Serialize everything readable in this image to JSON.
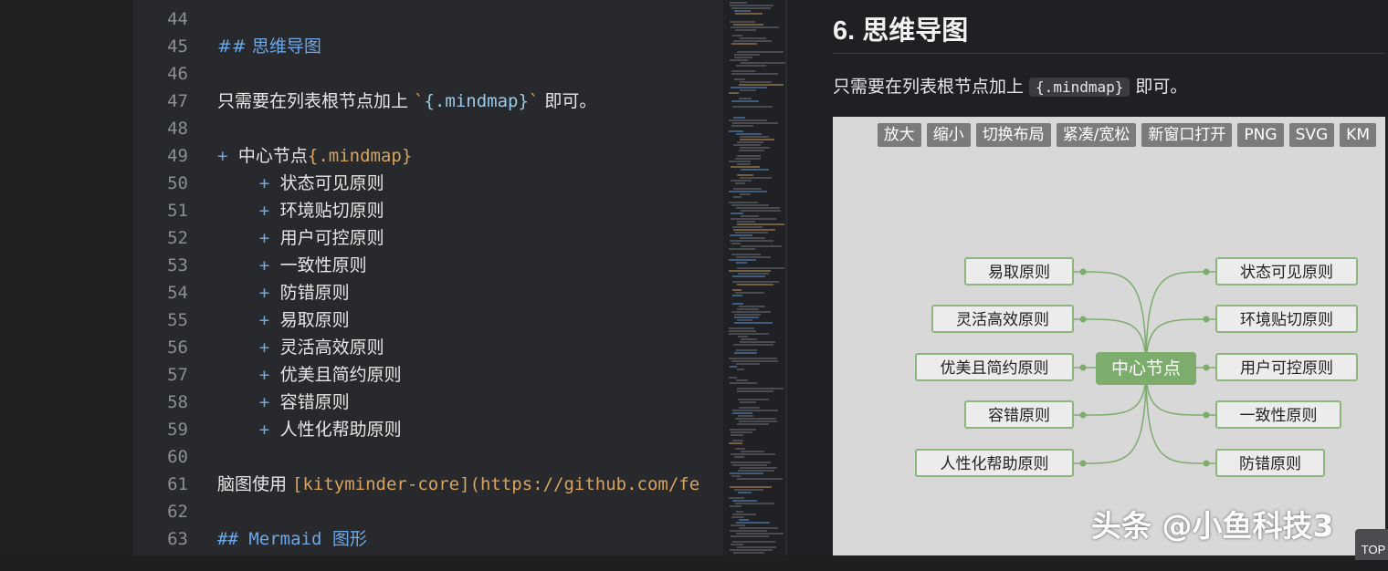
{
  "editor": {
    "lines": [
      {
        "num": "44",
        "parts": []
      },
      {
        "num": "45",
        "parts": [
          {
            "t": "## 思维导图",
            "c": "heading"
          }
        ]
      },
      {
        "num": "46",
        "parts": []
      },
      {
        "num": "47",
        "parts": [
          {
            "t": "只需要在列表根节点加上 ",
            "c": ""
          },
          {
            "t": "`",
            "c": "tick"
          },
          {
            "t": "{.mindmap}",
            "c": "codespan"
          },
          {
            "t": "`",
            "c": "tick"
          },
          {
            "t": " 即可。",
            "c": ""
          }
        ]
      },
      {
        "num": "48",
        "parts": []
      },
      {
        "num": "49",
        "parts": [
          {
            "t": "+ ",
            "c": "bullet"
          },
          {
            "t": "中心节点",
            "c": ""
          },
          {
            "t": "{.mindmap}",
            "c": "orange"
          }
        ]
      },
      {
        "num": "50",
        "parts": [
          {
            "t": "    + ",
            "c": "bullet"
          },
          {
            "t": "状态可见原则",
            "c": ""
          }
        ]
      },
      {
        "num": "51",
        "parts": [
          {
            "t": "    + ",
            "c": "bullet"
          },
          {
            "t": "环境贴切原则",
            "c": ""
          }
        ]
      },
      {
        "num": "52",
        "parts": [
          {
            "t": "    + ",
            "c": "bullet"
          },
          {
            "t": "用户可控原则",
            "c": ""
          }
        ]
      },
      {
        "num": "53",
        "parts": [
          {
            "t": "    + ",
            "c": "bullet"
          },
          {
            "t": "一致性原则",
            "c": ""
          }
        ]
      },
      {
        "num": "54",
        "parts": [
          {
            "t": "    + ",
            "c": "bullet"
          },
          {
            "t": "防错原则",
            "c": ""
          }
        ]
      },
      {
        "num": "55",
        "parts": [
          {
            "t": "    + ",
            "c": "bullet"
          },
          {
            "t": "易取原则",
            "c": ""
          }
        ]
      },
      {
        "num": "56",
        "parts": [
          {
            "t": "    + ",
            "c": "bullet"
          },
          {
            "t": "灵活高效原则",
            "c": ""
          }
        ]
      },
      {
        "num": "57",
        "parts": [
          {
            "t": "    + ",
            "c": "bullet"
          },
          {
            "t": "优美且简约原则",
            "c": ""
          }
        ]
      },
      {
        "num": "58",
        "parts": [
          {
            "t": "    + ",
            "c": "bullet"
          },
          {
            "t": "容错原则",
            "c": ""
          }
        ]
      },
      {
        "num": "59",
        "parts": [
          {
            "t": "    + ",
            "c": "bullet"
          },
          {
            "t": "人性化帮助原则",
            "c": ""
          }
        ]
      },
      {
        "num": "60",
        "parts": []
      },
      {
        "num": "61",
        "parts": [
          {
            "t": "脑图使用 ",
            "c": ""
          },
          {
            "t": "[kityminder-core](https://github.com/fe",
            "c": "url"
          }
        ]
      },
      {
        "num": "62",
        "parts": []
      },
      {
        "num": "63",
        "parts": [
          {
            "t": "## Mermaid ",
            "c": "heading mono"
          },
          {
            "t": "图形",
            "c": "heading"
          }
        ]
      }
    ]
  },
  "preview": {
    "title": "6. 思维导图",
    "para_before": "只需要在列表根节点加上 ",
    "para_code": "{.mindmap}",
    "para_after": " 即可。",
    "toolbar": [
      "放大",
      "缩小",
      "切换布局",
      "紧凑/宽松",
      "新窗口打开",
      "PNG",
      "SVG",
      "KM"
    ],
    "root": "中心节点",
    "right_nodes": [
      "状态可见原则",
      "环境贴切原则",
      "用户可控原则",
      "一致性原则",
      "防错原则"
    ],
    "left_nodes": [
      "易取原则",
      "灵活高效原则",
      "优美且简约原则",
      "容错原则",
      "人性化帮助原则"
    ],
    "accent_color": "#7cad6c"
  },
  "watermark": "头条 @小鱼科技3",
  "top_button": "TOP"
}
